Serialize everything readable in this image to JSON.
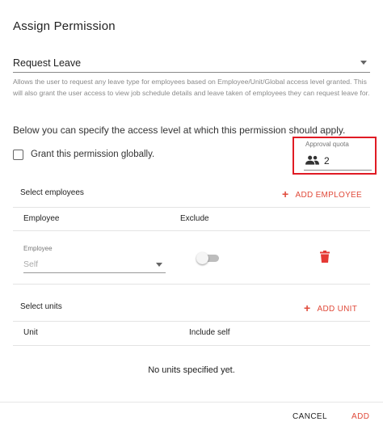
{
  "dialog": {
    "title": "Assign Permission"
  },
  "permission_select": {
    "value": "Request Leave",
    "help_text": "Allows the user to request any leave type for employees based on Employee/Unit/Global access level granted. This will also grant the user access to view job schedule details and leave taken of employees they can request leave for."
  },
  "access": {
    "description": "Below you can specify the access level at which this permission should apply.",
    "global_checkbox_label": "Grant this permission globally.",
    "global_checked": false
  },
  "approval_quota": {
    "label": "Approval quota",
    "value": "2",
    "icon": "people-icon",
    "highlight_color": "#e01b24"
  },
  "employees": {
    "section_title": "Select employees",
    "add_button": "ADD EMPLOYEE",
    "columns": [
      "Employee",
      "Exclude"
    ],
    "row": {
      "field_label": "Employee",
      "field_value": "Self",
      "exclude_on": false
    }
  },
  "units": {
    "section_title": "Select units",
    "add_button": "ADD UNIT",
    "columns": [
      "Unit",
      "Include self"
    ],
    "empty_message": "No units specified yet."
  },
  "footer": {
    "cancel": "CANCEL",
    "add": "ADD"
  },
  "colors": {
    "accent": "#e04a3a",
    "delete_icon": "#e53935"
  }
}
